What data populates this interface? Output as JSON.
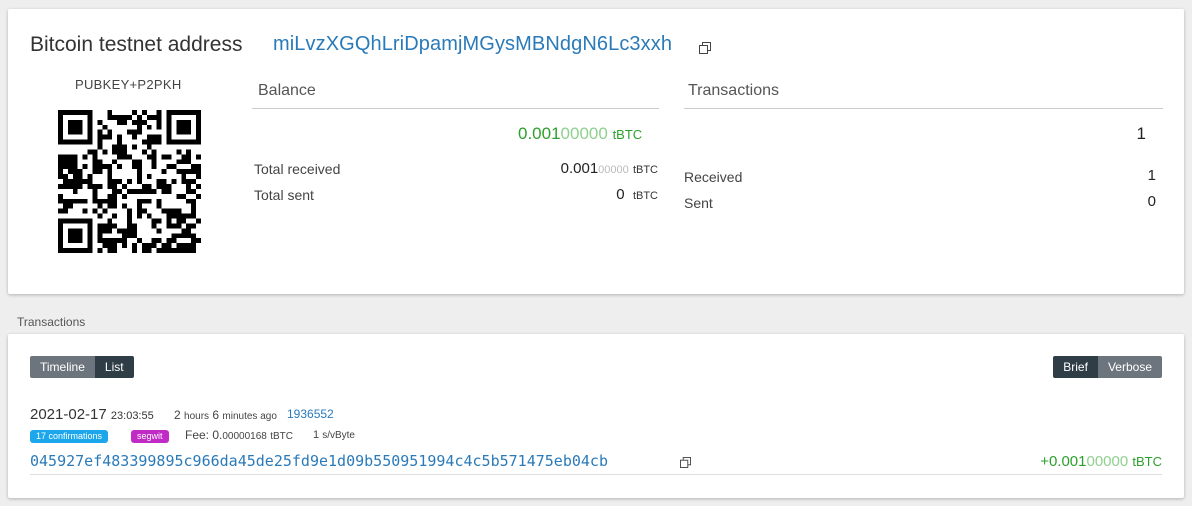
{
  "address": {
    "label": "Bitcoin testnet address",
    "value": "miLvzXGQhLriDpamjMGysMBNdgN6Lc3xxh",
    "type_caption": "PUBKEY+P2PKH"
  },
  "balance": {
    "title": "Balance",
    "amount_main": "0.001",
    "amount_light": "00000",
    "unit": "tBTC",
    "total_received_label": "Total received",
    "total_received_main": "0.001",
    "total_received_light": "00000",
    "total_sent_label": "Total sent",
    "total_sent_value": "0"
  },
  "transactions_summary": {
    "title": "Transactions",
    "count": "1",
    "received_label": "Received",
    "received_value": "1",
    "sent_label": "Sent",
    "sent_value": "0"
  },
  "tx_section": {
    "heading": "Transactions",
    "view_tabs": [
      "Timeline",
      "List"
    ],
    "detail_tabs": [
      "Brief",
      "Verbose"
    ]
  },
  "tx": {
    "date": "2021-02-17",
    "time": "23:03:55",
    "ago_h": "2",
    "ago_h_unit": "hours",
    "ago_m": "6",
    "ago_m_unit": "minutes ago",
    "block": "1936552",
    "confirmations": "17 confirmations",
    "segwit": "segwit",
    "fee_label": "Fee:",
    "fee_main": "0.",
    "fee_light": "00000168",
    "rate_value": "1",
    "rate_unit": "s/vByte",
    "txid": "045927ef483399895c966da45de25fd9e1d09b550951994c4c5b571475eb04cb",
    "amount_prefix": "+0.001",
    "amount_light": "00000"
  },
  "colors": {
    "link": "#2a7ab9",
    "positive": "#2ca02c",
    "badge_blue": "#1ca7ec",
    "badge_purple": "#c02bc6"
  }
}
